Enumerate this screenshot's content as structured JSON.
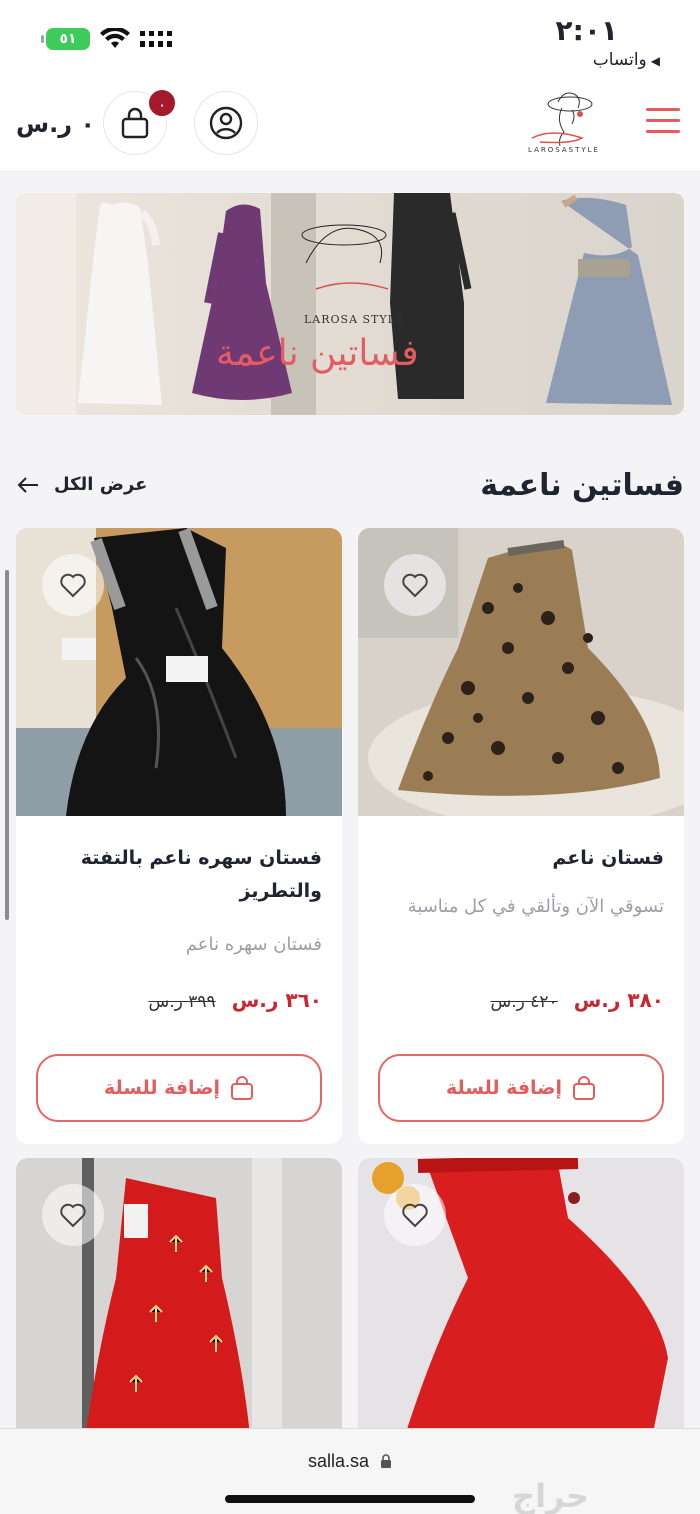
{
  "status_bar": {
    "time": "٢:٠١",
    "back_app": "واتساب",
    "battery": "٥١"
  },
  "header": {
    "cart_total": "٠ ر.س",
    "cart_badge": "٠",
    "logo_text": "LAROSASTYLE",
    "icons": [
      "menu-icon",
      "user-icon",
      "cart-icon"
    ]
  },
  "banner": {
    "brand": "LAROSA STYLE",
    "title": "فساتين ناعمة"
  },
  "section": {
    "title": "فساتين ناعمة",
    "view_all": "عرض الكل"
  },
  "products": [
    {
      "name": "فستان ناعم",
      "description": "تسوقي الآن وتألقي في كل مناسبة",
      "price": "٣٨٠ ر.س",
      "old_price": "٤٢٠ ر.س",
      "button": "إضافة للسلة"
    },
    {
      "name": "فستان سهره ناعم بالتفتة والتطريز",
      "description": "فستان سهره ناعم",
      "price": "٣٦٠ ر.س",
      "old_price": "٣٩٩ ر.س",
      "button": "إضافة للسلة"
    }
  ],
  "browser": {
    "url": "salla.sa",
    "watermark": "حراج"
  },
  "colors": {
    "accent": "#e35d5d",
    "price": "#c8272f",
    "badge": "#a31a2b"
  }
}
